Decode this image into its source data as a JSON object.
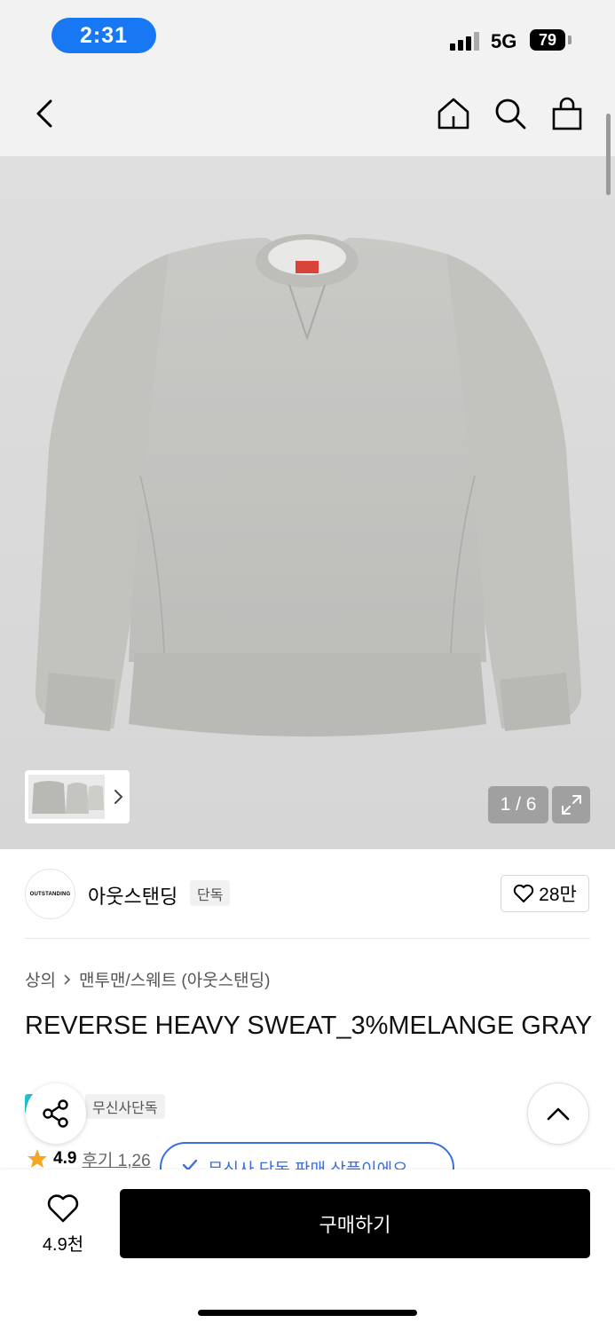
{
  "status_bar": {
    "time": "2:31",
    "network": "5G",
    "battery": "79"
  },
  "nav": {
    "back_icon": "chevron-left-icon",
    "home_icon": "home-icon",
    "search_icon": "search-icon",
    "cart_icon": "shopping-bag-icon"
  },
  "gallery": {
    "counter": "1 / 6",
    "current_index": 1,
    "total": 6,
    "expand_icon": "expand-icon"
  },
  "brand": {
    "logo_text": "OUTSTANDING",
    "name": "아웃스탠딩",
    "badge": "단독",
    "likes": "28만"
  },
  "breadcrumb": {
    "category": "상의",
    "subcategory": "맨투맨/스웨트 (아웃스탠딩)"
  },
  "product": {
    "title": "REVERSE HEAVY SWEAT_3%MELANGE GRAY",
    "tag": "무신사단독",
    "rating": "4.9",
    "reviews_label": "후기 1,26"
  },
  "toast": {
    "text": "무신사 단독 판매 상품이에요"
  },
  "bottom_bar": {
    "wish_count": "4.9천",
    "buy_label": "구매하기"
  },
  "colors": {
    "accent": "#1877f2",
    "toast_blue": "#3b6fe0",
    "star": "#f5a623",
    "tag_strip": "#20c3d4"
  }
}
